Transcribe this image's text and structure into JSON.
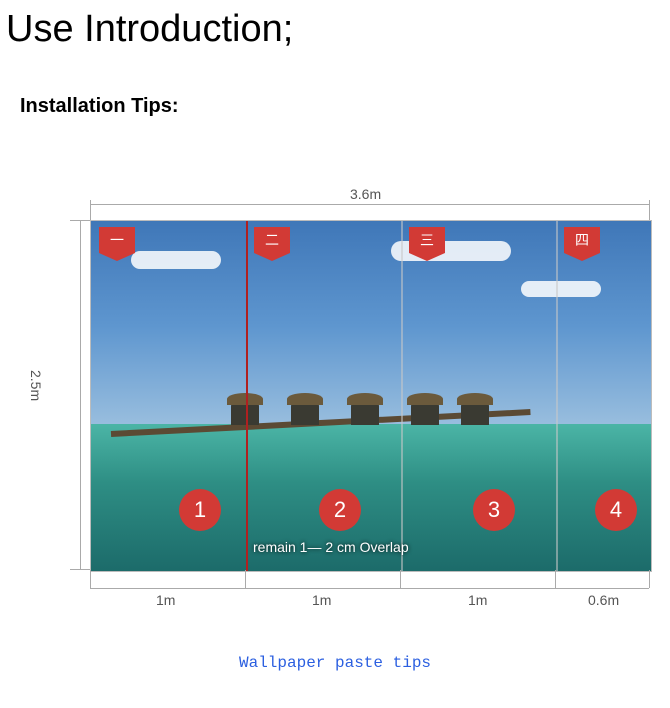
{
  "heading": "Use Introduction;",
  "subtitle": "Installation Tips:",
  "dims": {
    "width": "3.6m",
    "height": "2.5m"
  },
  "panels": [
    {
      "tab": "一",
      "num": "1",
      "widthLabel": "1m"
    },
    {
      "tab": "二",
      "num": "2",
      "widthLabel": "1m"
    },
    {
      "tab": "三",
      "num": "3",
      "widthLabel": "1m"
    },
    {
      "tab": "四",
      "num": "4",
      "widthLabel": "0.6m"
    }
  ],
  "overlapNote": "remain 1— 2 cm Overlap",
  "caption": "Wallpaper paste tips"
}
